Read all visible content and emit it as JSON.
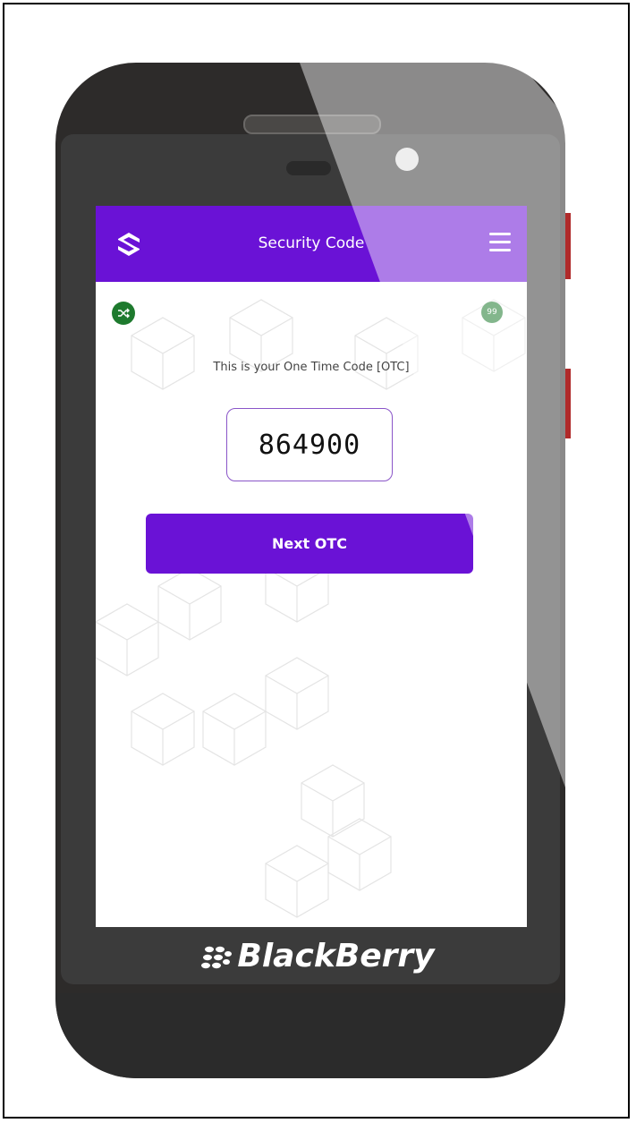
{
  "device": {
    "brand_label": "BlackBerry"
  },
  "app": {
    "title": "Security Code",
    "colors": {
      "primary": "#6a12d6",
      "badge": "#1e7a2e",
      "code_border": "#8a55c8"
    },
    "icons": {
      "logo": "app-logo-s-icon",
      "menu": "hamburger-menu-icon",
      "shuffle": "shuffle-icon",
      "count": "quote-count-icon"
    },
    "count_badge": "99",
    "otc_caption": "This is your One Time Code [OTC]",
    "otc_code": "864900",
    "next_button_label": "Next OTC"
  }
}
